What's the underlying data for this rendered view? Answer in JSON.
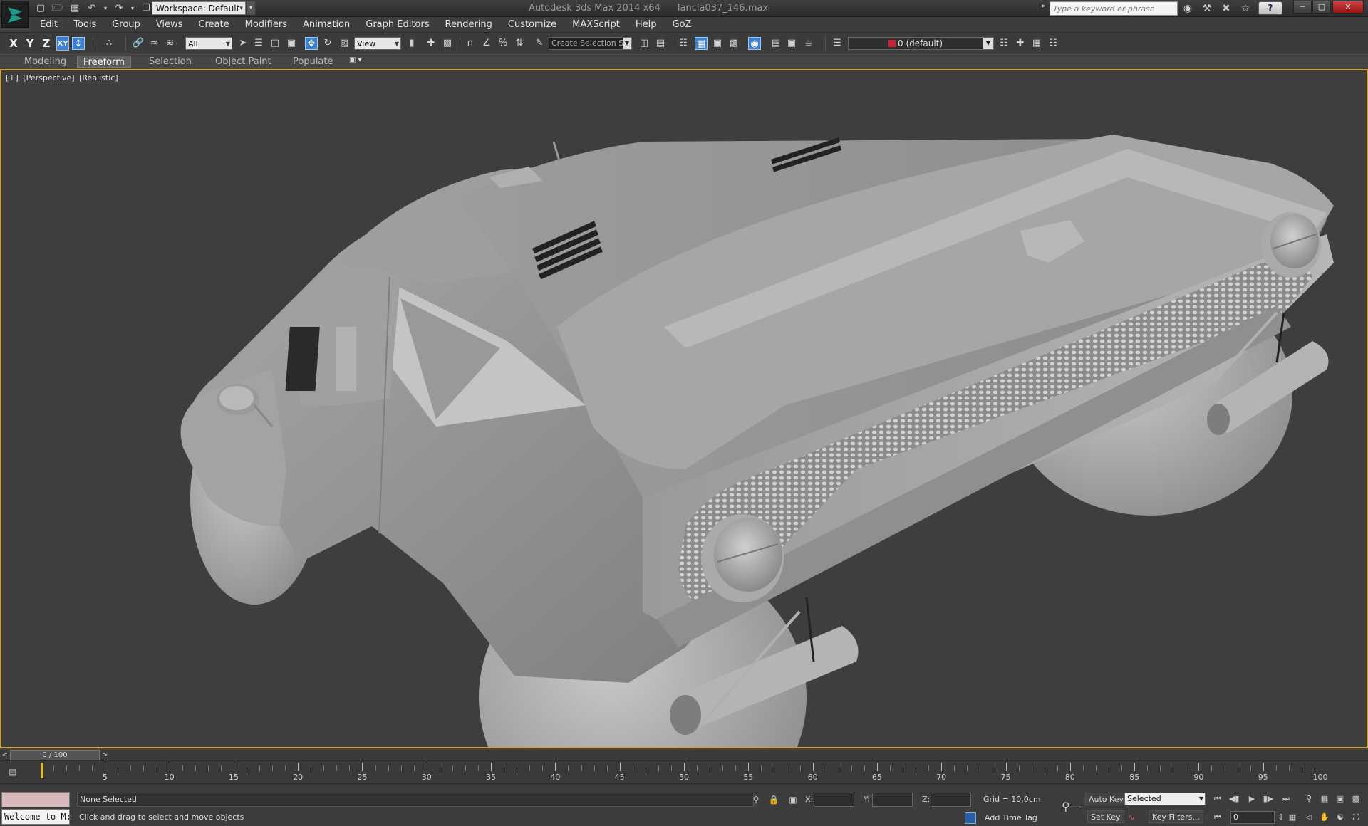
{
  "title_bar": {
    "app_name": "Autodesk 3ds Max  2014 x64",
    "file_name": "lancia037_146.max",
    "workspace_label": "Workspace: Default",
    "search_placeholder": "Type a keyword or phrase"
  },
  "menu": {
    "items": [
      "Edit",
      "Tools",
      "Group",
      "Views",
      "Create",
      "Modifiers",
      "Animation",
      "Graph Editors",
      "Rendering",
      "Customize",
      "MAXScript",
      "Help",
      "GoZ"
    ]
  },
  "toolbar": {
    "axis_x": "X",
    "axis_y": "Y",
    "axis_z": "Z",
    "axis_xy": "XY",
    "selection_filter": "All",
    "reference_coord": "View",
    "named_selection_placeholder": "Create Selection Se",
    "layer_name": "0 (default)",
    "layer_color": "#cc2233"
  },
  "ribbon": {
    "tabs": [
      "Modeling",
      "Freeform",
      "Selection",
      "Object Paint",
      "Populate"
    ],
    "active_tab": "Freeform"
  },
  "viewport": {
    "label_plus": "[+]",
    "label_view": "[Perspective]",
    "label_shading": "[Realistic]",
    "border_color": "#c9a640",
    "background_color": "#3e3e3e"
  },
  "time_slider": {
    "position_text": "0 / 100",
    "left_arrow": "<",
    "right_arrow": ">"
  },
  "track_bar": {
    "ticks": [
      "5",
      "10",
      "15",
      "20",
      "25",
      "30",
      "35",
      "40",
      "45",
      "50",
      "55",
      "60",
      "65",
      "70",
      "75",
      "80",
      "85",
      "90",
      "95",
      "100"
    ]
  },
  "status_bar": {
    "listener_text": "Welcome to M:",
    "selection_status": "None Selected",
    "prompt": "Click and drag to select and move objects",
    "x_label": "X:",
    "y_label": "Y:",
    "z_label": "Z:",
    "grid": "Grid = 10,0cm",
    "add_time_tag": "Add Time Tag",
    "auto_key": "Auto Key",
    "set_key": "Set Key",
    "key_mode": "Selected",
    "key_filters": "Key Filters...",
    "current_frame": "0"
  }
}
